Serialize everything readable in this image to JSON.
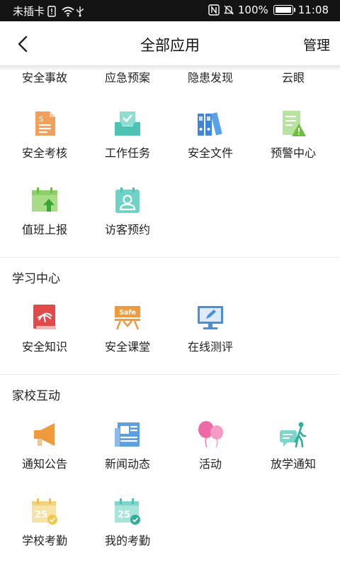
{
  "status_bar": {
    "carrier": "未插卡",
    "battery_percent": "100%",
    "battery_level": 1.0,
    "time": "11:08"
  },
  "header": {
    "back_icon": "chevron-left-icon",
    "title": "全部应用",
    "manage_label": "管理"
  },
  "top_group": {
    "row0": [
      {
        "label": "安全事故"
      },
      {
        "label": "应急预案"
      },
      {
        "label": "隐患发现"
      },
      {
        "label": "云眼"
      }
    ],
    "row1": [
      {
        "label": "安全考核",
        "icon": "document-list-icon"
      },
      {
        "label": "工作任务",
        "icon": "inbox-check-icon"
      },
      {
        "label": "安全文件",
        "icon": "binders-icon"
      },
      {
        "label": "预警中心",
        "icon": "warning-document-icon"
      }
    ],
    "row2": [
      {
        "label": "值班上报",
        "icon": "calendar-upload-icon"
      },
      {
        "label": "访客预约",
        "icon": "visitor-calendar-icon"
      }
    ]
  },
  "study_section": {
    "title": "学习中心",
    "items": [
      {
        "label": "安全知识",
        "icon": "knowledge-book-icon"
      },
      {
        "label": "安全课堂",
        "icon": "safe-classroom-icon",
        "badge": "Safe"
      },
      {
        "label": "在线测评",
        "icon": "monitor-edit-icon"
      }
    ]
  },
  "family_section": {
    "title": "家校互动",
    "row1": [
      {
        "label": "通知公告",
        "icon": "megaphone-icon"
      },
      {
        "label": "新闻动态",
        "icon": "newspaper-icon"
      },
      {
        "label": "活动",
        "icon": "balloons-icon"
      },
      {
        "label": "放学通知",
        "icon": "walking-message-icon"
      }
    ],
    "row2": [
      {
        "label": "学校考勤",
        "icon": "school-attendance-calendar-icon",
        "day": "25"
      },
      {
        "label": "我的考勤",
        "icon": "my-attendance-calendar-icon",
        "day": "25"
      }
    ]
  },
  "colors": {
    "orange": "#f0a05a",
    "teal": "#4ec3b3",
    "blue": "#4a90d9",
    "green": "#8cd06a",
    "red": "#e04a4a",
    "pink": "#ee6aa7"
  }
}
